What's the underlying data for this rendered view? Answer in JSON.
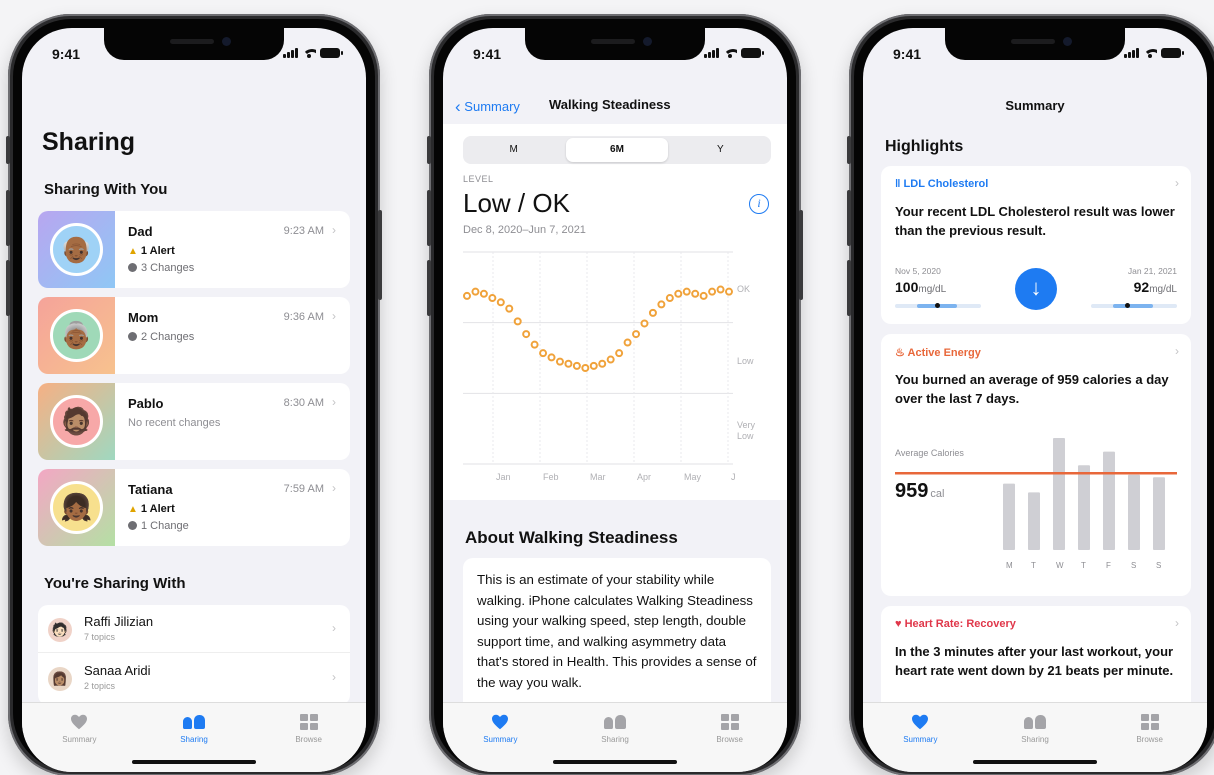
{
  "status": {
    "time": "9:41"
  },
  "tabs": {
    "summary": "Summary",
    "sharing": "Sharing",
    "browse": "Browse"
  },
  "phone1": {
    "title": "Sharing",
    "sharing_with_you": "Sharing With You",
    "people": [
      {
        "name": "Dad",
        "time": "9:23 AM",
        "alert": "1 Alert",
        "changes": "3 Changes",
        "emoji": "👴🏾"
      },
      {
        "name": "Mom",
        "time": "9:36 AM",
        "alert": "",
        "changes": "2 Changes",
        "emoji": "👵🏾"
      },
      {
        "name": "Pablo",
        "time": "8:30 AM",
        "alert": "",
        "changes": "No recent changes",
        "emoji": "🧔🏽"
      },
      {
        "name": "Tatiana",
        "time": "7:59 AM",
        "alert": "1 Alert",
        "changes": "1 Change",
        "emoji": "👧🏾"
      }
    ],
    "youre_sharing_with": "You're Sharing With",
    "shares": [
      {
        "name": "Raffi Jilizian",
        "sub": "7 topics",
        "emoji": "🧑🏻"
      },
      {
        "name": "Sanaa Aridi",
        "sub": "2 topics",
        "emoji": "👩🏽"
      }
    ]
  },
  "phone2": {
    "back": "Summary",
    "title": "Walking Steadiness",
    "segments": [
      "M",
      "6M",
      "Y"
    ],
    "selected_segment": "6M",
    "level_label": "LEVEL",
    "level_value": "Low / OK",
    "date_range": "Dec 8, 2020–Jun 7, 2021",
    "chart_data": {
      "type": "scatter",
      "x_labels": [
        "Jan",
        "Feb",
        "Mar",
        "Apr",
        "May",
        "J"
      ],
      "y_labels": [
        "OK",
        "Low",
        "Very Low"
      ],
      "values": [
        0.84,
        0.86,
        0.85,
        0.83,
        0.81,
        0.78,
        0.72,
        0.66,
        0.61,
        0.57,
        0.55,
        0.53,
        0.52,
        0.51,
        0.5,
        0.51,
        0.52,
        0.54,
        0.57,
        0.62,
        0.66,
        0.71,
        0.76,
        0.8,
        0.83,
        0.85,
        0.86,
        0.85,
        0.84,
        0.86,
        0.87,
        0.86
      ],
      "point_color": "#f0a23a"
    },
    "about_title": "About Walking Steadiness",
    "about_text": "This is an estimate of your stability while walking. iPhone calculates Walking Steadiness using your walking speed, step length, double support time, and walking asymmetry data that's stored in Health. This provides a sense of the way you walk."
  },
  "phone3": {
    "title": "Summary",
    "highlights": "Highlights",
    "ldl": {
      "category": "LDL Cholesterol",
      "message": "Your recent LDL Cholesterol result was lower than the previous result.",
      "from_date": "Nov 5, 2020",
      "from_value": "100",
      "to_date": "Jan 21, 2021",
      "to_value": "92",
      "unit": "mg/dL",
      "color": "#1e7bf2"
    },
    "energy": {
      "category": "Active Energy",
      "message": "You burned an average of 959 calories a day over the last 7 days.",
      "avg_label": "Average Calories",
      "avg_value": "959",
      "avg_unit": "cal",
      "color": "#e8673a",
      "chart_data": {
        "type": "bar",
        "categories": [
          "M",
          "T",
          "W",
          "T",
          "F",
          "S",
          "S"
        ],
        "values": [
          830,
          720,
          1400,
          1060,
          1230,
          940,
          910
        ],
        "average": 959,
        "ylim": [
          0,
          1500
        ]
      }
    },
    "heart": {
      "category": "Heart Rate: Recovery",
      "message": "In the 3 minutes after your last workout, your heart rate went down by 21 beats per minute.",
      "color": "#e0374a"
    }
  }
}
